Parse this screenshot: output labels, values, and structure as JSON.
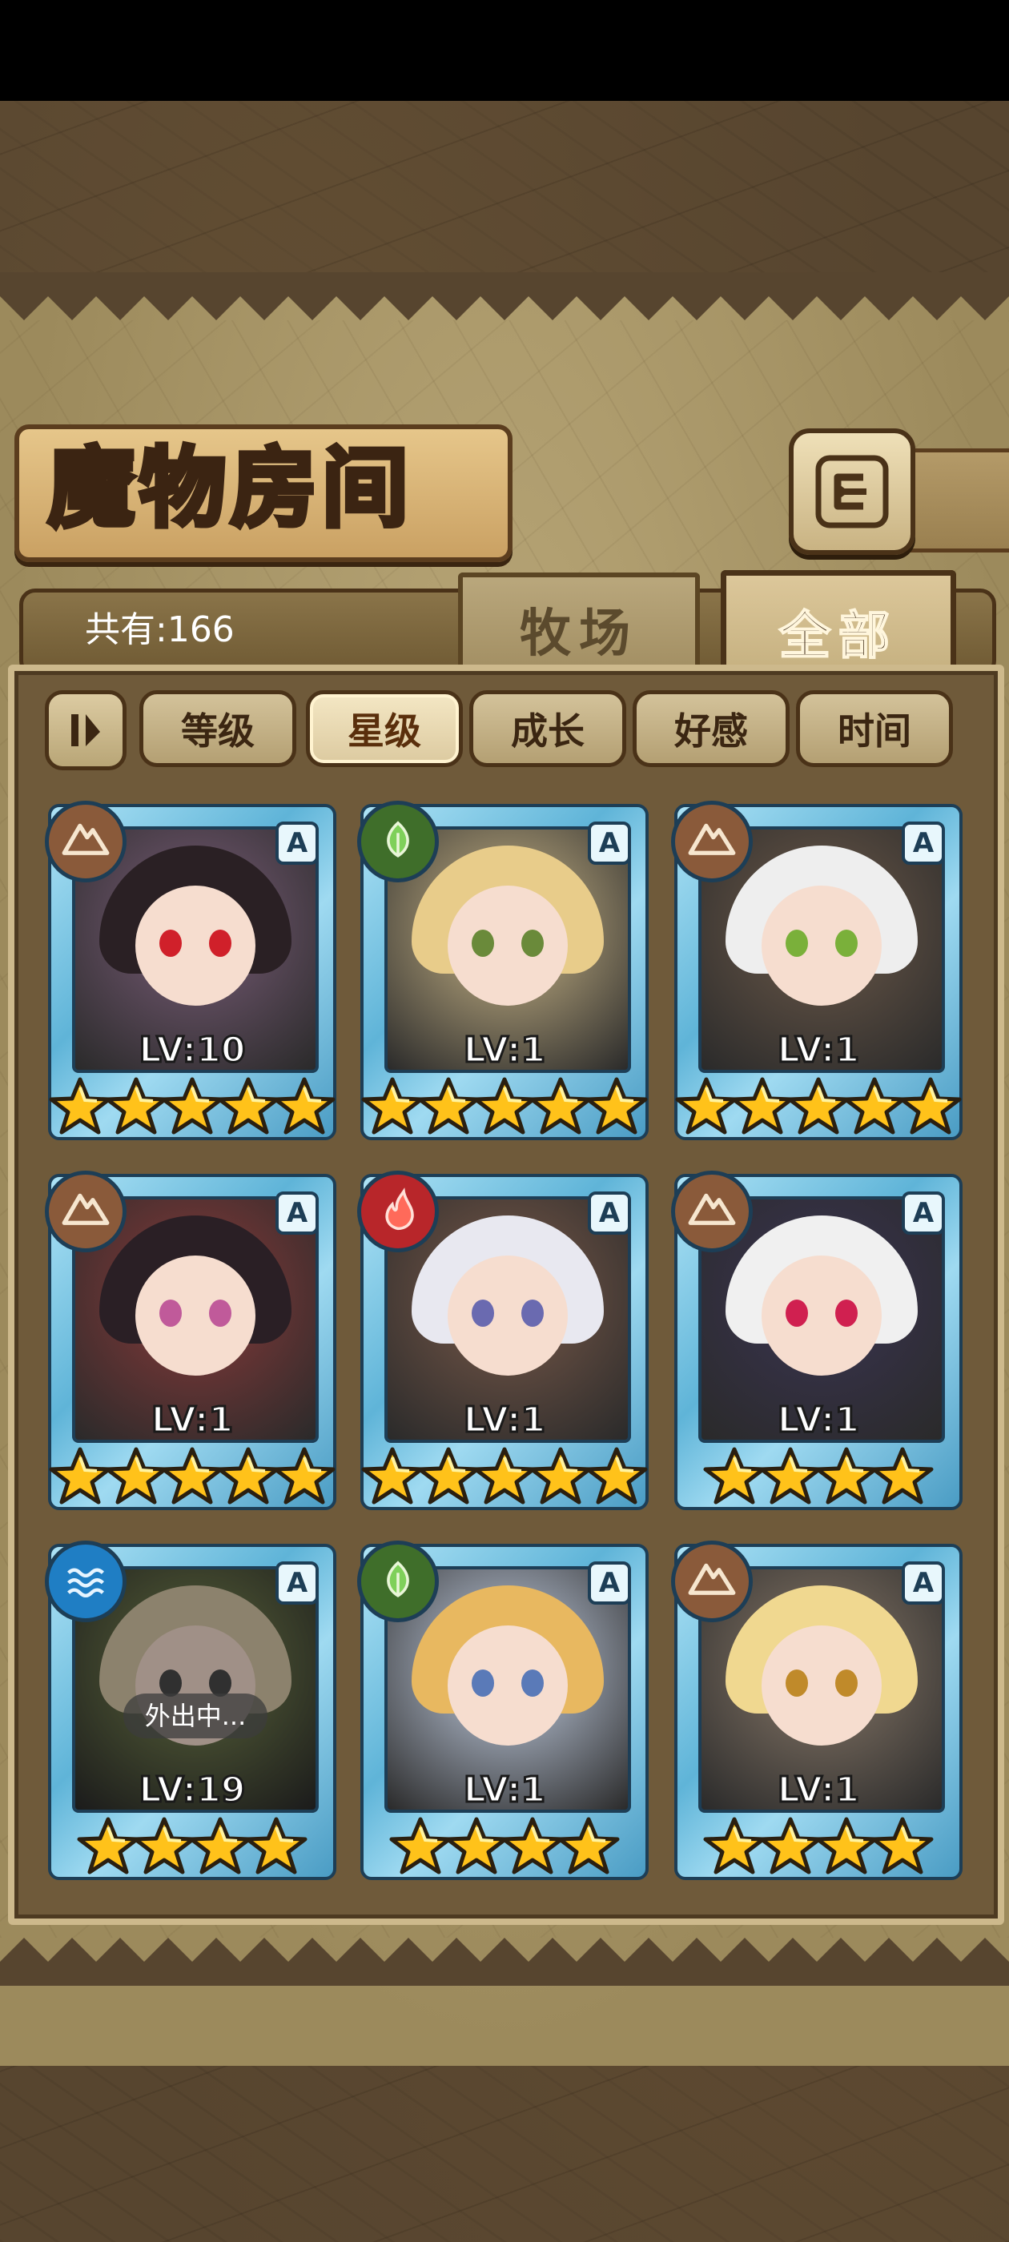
{
  "title": "魔物房间",
  "total_count_label": "共有:166",
  "tabs": [
    {
      "label": "牧场",
      "active": false
    },
    {
      "label": "全部",
      "active": true
    }
  ],
  "sort_buttons": [
    {
      "label": "等级",
      "active": false
    },
    {
      "label": "星级",
      "active": true
    },
    {
      "label": "成长",
      "active": false
    },
    {
      "label": "好感",
      "active": false
    },
    {
      "label": "时间",
      "active": false
    }
  ],
  "rank_letter": "A",
  "colors": {
    "earth": "#8a5a3a",
    "nature": "#3f6e2a",
    "fire": "#b8262a",
    "water": "#1f7ec4",
    "card_frame": "#5fb4d8"
  },
  "cards": [
    {
      "element": "earth",
      "element_icon": "mountain-icon",
      "level": "LV:10",
      "stars": 5,
      "away": ""
    },
    {
      "element": "nature",
      "element_icon": "leaf-icon",
      "level": "LV:1",
      "stars": 5,
      "away": ""
    },
    {
      "element": "earth",
      "element_icon": "mountain-icon",
      "level": "LV:1",
      "stars": 5,
      "away": ""
    },
    {
      "element": "earth",
      "element_icon": "mountain-icon",
      "level": "LV:1",
      "stars": 5,
      "away": ""
    },
    {
      "element": "fire",
      "element_icon": "flame-icon",
      "level": "LV:1",
      "stars": 5,
      "away": ""
    },
    {
      "element": "earth",
      "element_icon": "mountain-icon",
      "level": "LV:1",
      "stars": 4,
      "away": ""
    },
    {
      "element": "water",
      "element_icon": "waves-icon",
      "level": "LV:19",
      "stars": 4,
      "away": "外出中..."
    },
    {
      "element": "nature",
      "element_icon": "leaf-icon",
      "level": "LV:1",
      "stars": 4,
      "away": ""
    },
    {
      "element": "earth",
      "element_icon": "mountain-icon",
      "level": "LV:1",
      "stars": 4,
      "away": ""
    }
  ]
}
